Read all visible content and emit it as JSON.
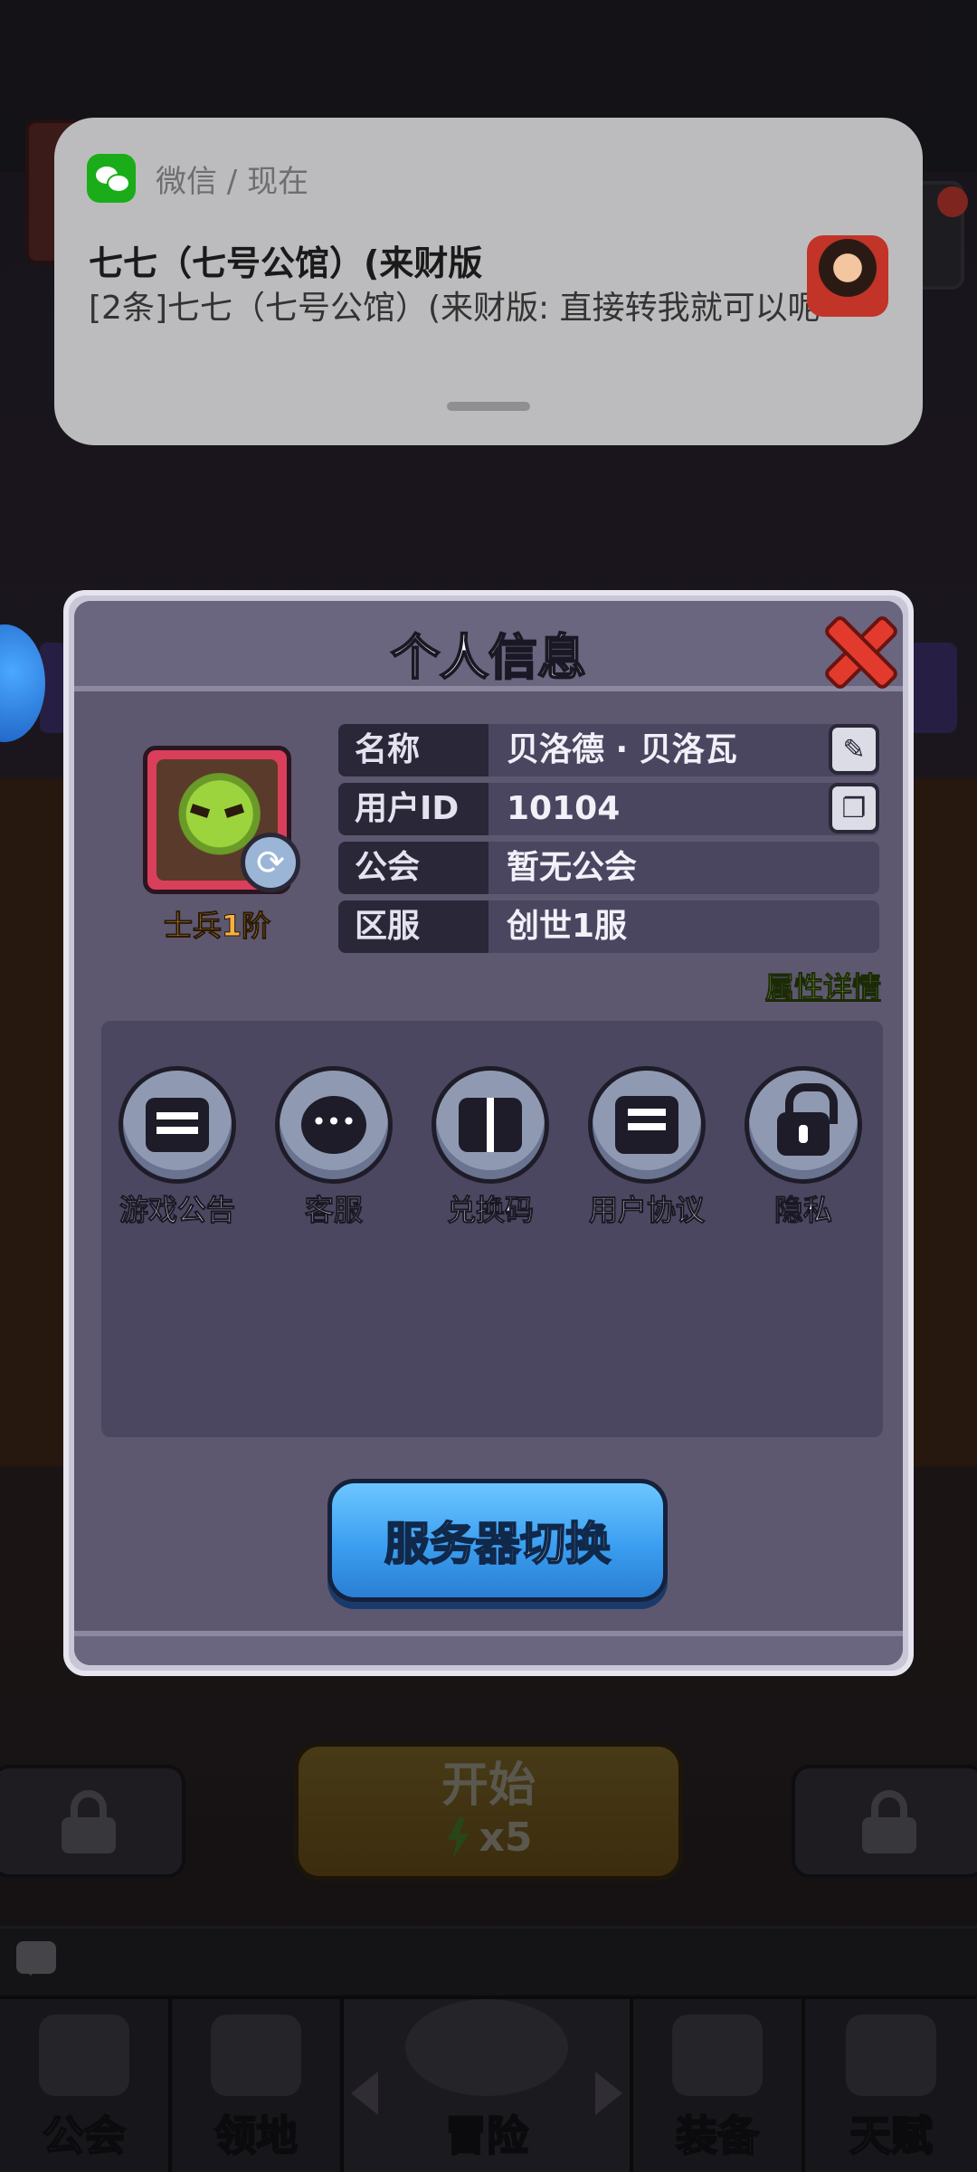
{
  "notification": {
    "app": "微信 / 现在",
    "title": "七七（七号公馆）(来财版",
    "body": "[2条]七七（七号公馆）(来财版: 直接转我就可以呢"
  },
  "dialog": {
    "title": "个人信息",
    "rank": "士兵1阶",
    "info": [
      {
        "key": "名称",
        "value": "贝洛德 · 贝洛瓦"
      },
      {
        "key": "用户ID",
        "value": "10104"
      },
      {
        "key": "公会",
        "value": "暂无公会"
      },
      {
        "key": "区服",
        "value": "创世1服"
      }
    ],
    "attr_link": "属性详情",
    "functions": [
      {
        "label": "游戏公告",
        "icon": "notice-board-icon"
      },
      {
        "label": "客服",
        "icon": "customer-service-icon"
      },
      {
        "label": "兑换码",
        "icon": "gift-icon"
      },
      {
        "label": "用户协议",
        "icon": "agreement-icon"
      },
      {
        "label": "隐私",
        "icon": "lock-icon"
      }
    ],
    "server_switch": "服务器切换"
  },
  "background": {
    "start_label": "开始",
    "start_cost": "x5",
    "tabs": [
      "公会",
      "领地",
      "冒险",
      "装备",
      "天赋"
    ]
  }
}
